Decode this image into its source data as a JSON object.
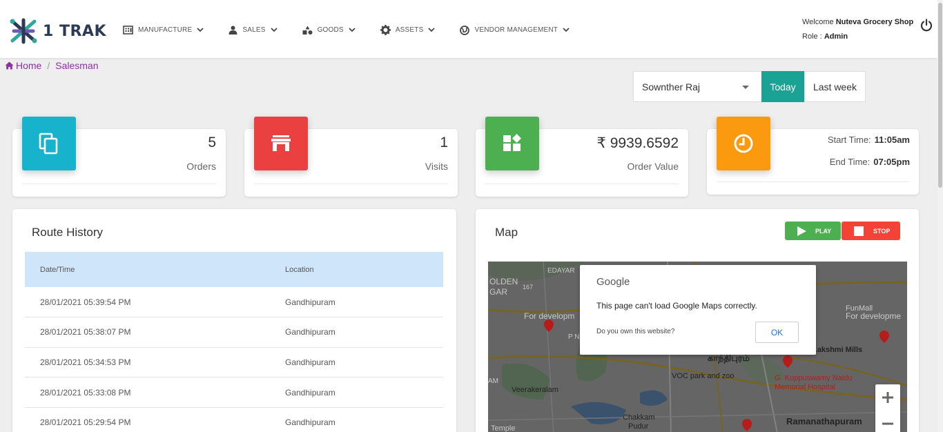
{
  "brand": {
    "name": "1 TRAK"
  },
  "nav": [
    {
      "label": "MANUFACTURE",
      "icon": "building-icon"
    },
    {
      "label": "SALES",
      "icon": "user-icon"
    },
    {
      "label": "GOODS",
      "icon": "shapes-icon"
    },
    {
      "label": "ASSETS",
      "icon": "gear-icon"
    },
    {
      "label": "VENDOR MANAGEMENT",
      "icon": "globe-icon"
    }
  ],
  "user": {
    "welcome_prefix": "Welcome",
    "shop": "Nuteva Grocery Shop",
    "role_prefix": "Role :",
    "role": "Admin"
  },
  "breadcrumb": {
    "home": "Home",
    "current": "Salesman"
  },
  "filter": {
    "salesman": "Sownther Raj",
    "today": "Today",
    "last_week": "Last week"
  },
  "stats": {
    "orders": {
      "value": "5",
      "label": "Orders",
      "color": "#17b3cc"
    },
    "visits": {
      "value": "1",
      "label": "Visits",
      "color": "#eb4040"
    },
    "order_value": {
      "value": "₹ 9939.6592",
      "label": "Order Value",
      "color": "#4caf50"
    },
    "time": {
      "start_label": "Start Time:",
      "start": "11:05am",
      "end_label": "End Time:",
      "end": "07:05pm",
      "color": "#fb9a0e"
    }
  },
  "route_history": {
    "title": "Route History",
    "columns": [
      "Date/Time",
      "Location"
    ],
    "rows": [
      [
        "28/01/2021 05:39:54 PM",
        "Gandhipuram"
      ],
      [
        "28/01/2021 05:38:07 PM",
        "Gandhipuram"
      ],
      [
        "28/01/2021 05:34:53 PM",
        "Gandhipuram"
      ],
      [
        "28/01/2021 05:33:08 PM",
        "Gandhipuram"
      ],
      [
        "28/01/2021 05:29:54 PM",
        "Gandhipuram"
      ]
    ]
  },
  "map": {
    "title": "Map",
    "play": "PLAY",
    "stop": "STOP",
    "dialog": {
      "logo": "Google",
      "message": "This page can't load Google Maps correctly.",
      "own": "Do you own this website?",
      "ok": "OK"
    },
    "labels": {
      "edayar": "EDAYAR",
      "golden": "OLDEN",
      "gar": "GAR",
      "dev1": "For developm",
      "dev2": "For developme",
      "funmall": "FunMall",
      "lakshmi": "Lakshmi Mills",
      "gandhipuram_ta": "காந்திபுரம்",
      "voc": "VOC park and zoo",
      "veera": "Veerakeralam",
      "kuppu": "G. Kuppuswamy Naidu",
      "memorial": "Memorial Hospital",
      "chakkam": "Chakkam",
      "pudur": "Pudur",
      "ramana": "Ramanathapuram",
      "temple": "Temple",
      "am": "AM",
      "pn": "P N",
      "road167": "167"
    }
  }
}
